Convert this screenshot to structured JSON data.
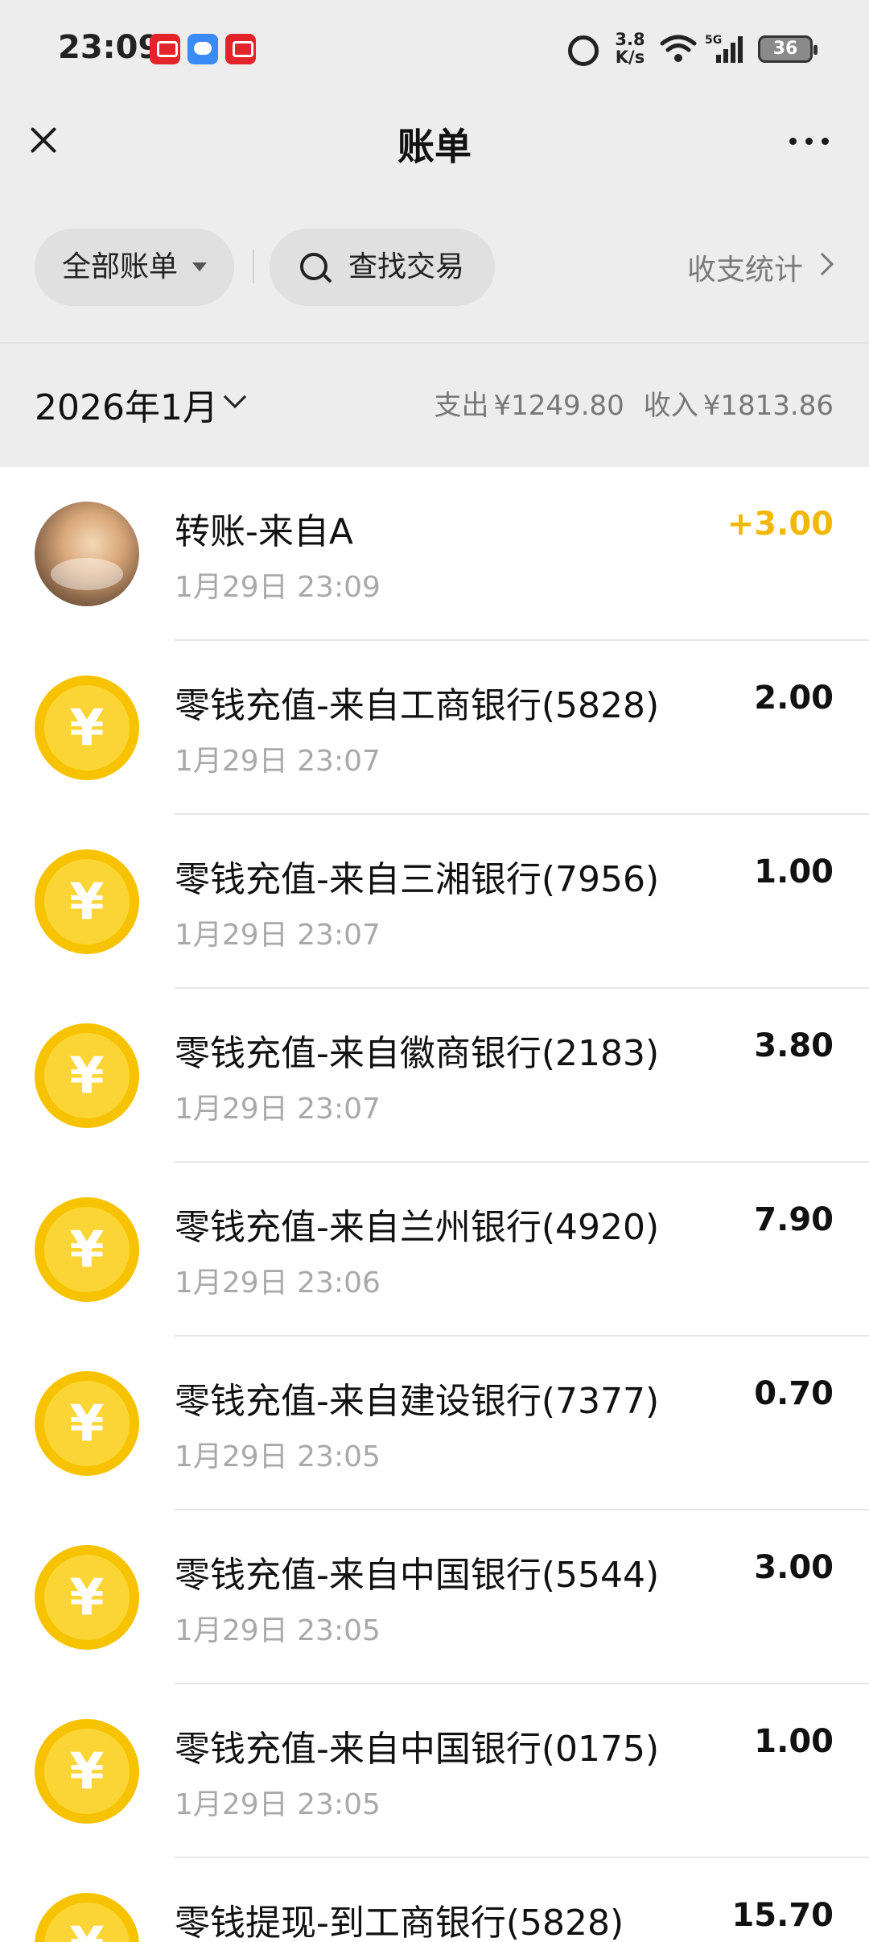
{
  "status_bar": {
    "time": "23:09",
    "net_speed_value": "3.8",
    "net_speed_unit": "K/s",
    "network_type": "5G",
    "battery_level": "36",
    "icons": [
      "app-notification-icon",
      "message-notification-icon",
      "app-notification-icon",
      "alarm-icon",
      "wifi-icon",
      "signal-icon",
      "battery-icon"
    ]
  },
  "header": {
    "title": "账单"
  },
  "filters": {
    "all_bills_label": "全部账单",
    "search_label": "查找交易",
    "stats_link_label": "收支统计"
  },
  "month": {
    "label": "2026年1月",
    "expense_label": "支出",
    "expense_value": "¥1249.80",
    "income_label": "收入",
    "income_value": "¥1813.86"
  },
  "transactions": [
    {
      "icon": "avatar",
      "title": "转账-来自A",
      "time": "1月29日 23:09",
      "amount": "+3.00",
      "is_income": true
    },
    {
      "icon": "yuan-coin-icon",
      "title": "零钱充值-来自工商银行(5828)",
      "time": "1月29日 23:07",
      "amount": "2.00",
      "is_income": false
    },
    {
      "icon": "yuan-coin-icon",
      "title": "零钱充值-来自三湘银行(7956)",
      "time": "1月29日 23:07",
      "amount": "1.00",
      "is_income": false
    },
    {
      "icon": "yuan-coin-icon",
      "title": "零钱充值-来自徽商银行(2183)",
      "time": "1月29日 23:07",
      "amount": "3.80",
      "is_income": false
    },
    {
      "icon": "yuan-coin-icon",
      "title": "零钱充值-来自兰州银行(4920)",
      "time": "1月29日 23:06",
      "amount": "7.90",
      "is_income": false
    },
    {
      "icon": "yuan-coin-icon",
      "title": "零钱充值-来自建设银行(7377)",
      "time": "1月29日 23:05",
      "amount": "0.70",
      "is_income": false
    },
    {
      "icon": "yuan-coin-icon",
      "title": "零钱充值-来自中国银行(5544)",
      "time": "1月29日 23:05",
      "amount": "3.00",
      "is_income": false
    },
    {
      "icon": "yuan-coin-icon",
      "title": "零钱充值-来自中国银行(0175)",
      "time": "1月29日 23:05",
      "amount": "1.00",
      "is_income": false
    },
    {
      "icon": "yuan-coin-icon",
      "title": "零钱提现-到工商银行(5828)",
      "time": "",
      "amount": "15.70",
      "is_income": false
    }
  ],
  "colors": {
    "background_top": "#ededed",
    "coin_yellow": "#f7c300",
    "income_amount": "#f2b807",
    "secondary_text": "#a9a9a9"
  },
  "coin_glyph": "¥"
}
